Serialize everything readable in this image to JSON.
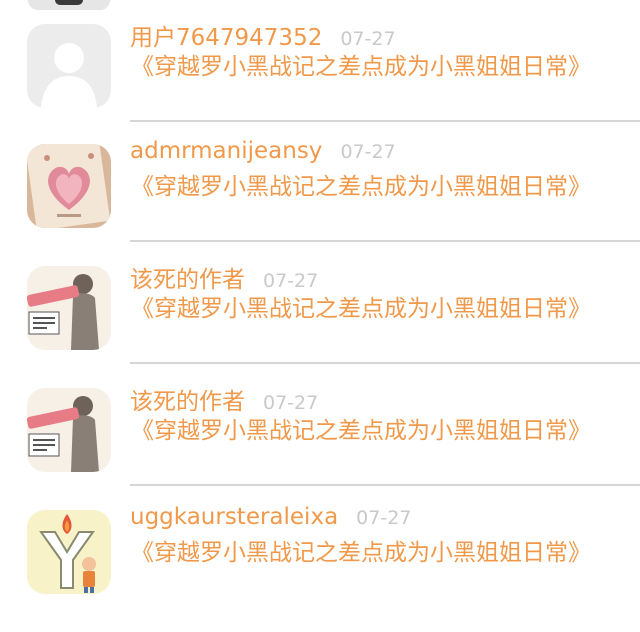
{
  "comments": [
    {
      "username": "用户7647947352",
      "date": "07-27",
      "message": "《穿越罗小黑战记之差点成为小黑姐姐日常》",
      "avatar": "default-person-avatar"
    },
    {
      "username": "admrmanijeansy",
      "date": "07-27",
      "message": "《穿越罗小黑战记之差点成为小黑姐姐日常》",
      "avatar": "pink-heart-card-avatar"
    },
    {
      "username": "该死的作者",
      "date": "07-27",
      "message": "《穿越罗小黑战记之差点成为小黑姐姐日常》",
      "avatar": "comic-character-avatar"
    },
    {
      "username": "该死的作者",
      "date": "07-27",
      "message": "《穿越罗小黑战记之差点成为小黑姐姐日常》",
      "avatar": "comic-character-avatar"
    },
    {
      "username": "uggkaursteraleixa",
      "date": "07-27",
      "message": "《穿越罗小黑战记之差点成为小黑姐姐日常》",
      "avatar": "y-torch-avatar"
    }
  ],
  "colors": {
    "accent": "#f0994a",
    "date": "#c9c9c9",
    "divider": "#d6d6d6"
  }
}
